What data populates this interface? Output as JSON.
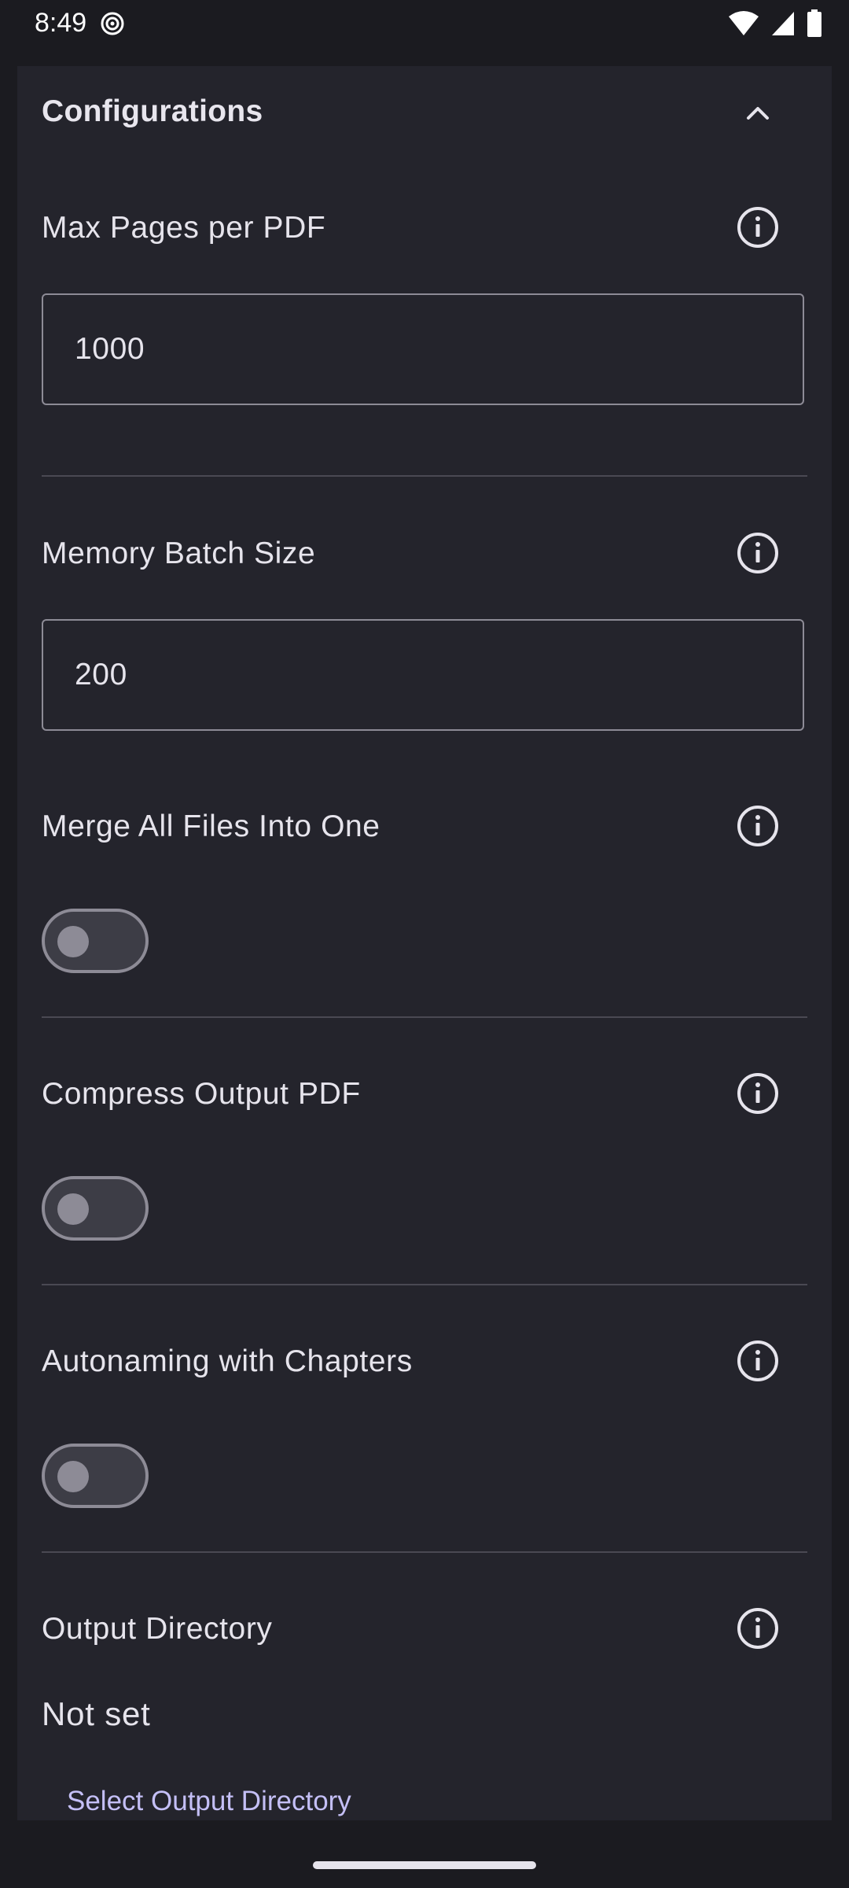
{
  "status_bar": {
    "time": "8:49",
    "icons": [
      "sync-ring-icon",
      "wifi-icon",
      "signal-icon",
      "battery-icon"
    ]
  },
  "section": {
    "title": "Configurations",
    "collapse_icon": "chevron-up-icon"
  },
  "settings": {
    "max_pages": {
      "label": "Max Pages per PDF",
      "value": "1000"
    },
    "memory_batch": {
      "label": "Memory Batch Size",
      "value": "200"
    },
    "merge_files": {
      "label": "Merge All Files Into One",
      "enabled": false
    },
    "compress_output": {
      "label": "Compress Output PDF",
      "enabled": false
    },
    "autonaming": {
      "label": "Autonaming with Chapters",
      "enabled": false
    },
    "output_directory": {
      "label": "Output Directory",
      "value": "Not set",
      "button": "Select Output Directory"
    }
  },
  "colors": {
    "background": "#1b1b20",
    "card": "#24242c",
    "accent_link": "#c4bff6",
    "outline": "#8d8b96"
  }
}
